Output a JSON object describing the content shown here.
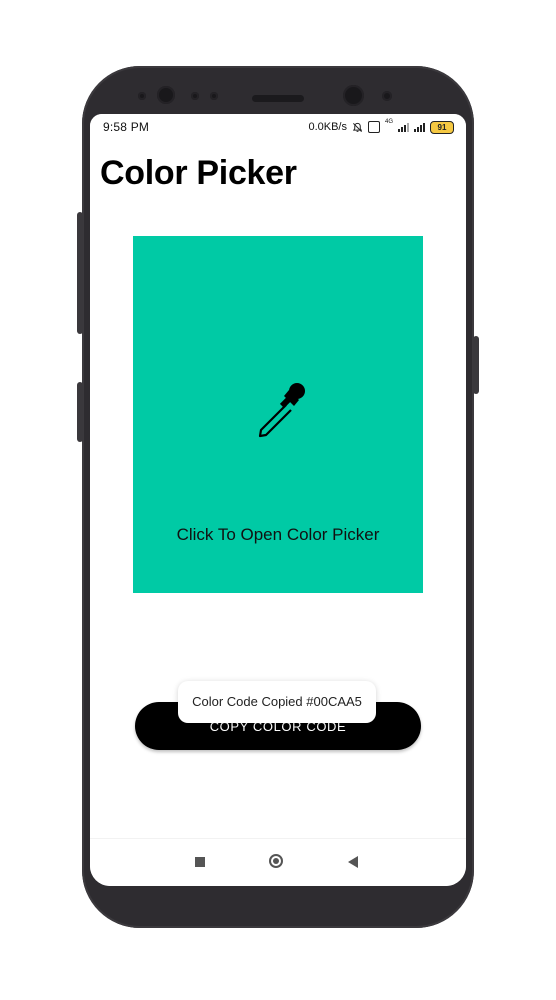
{
  "status_bar": {
    "time": "9:58 PM",
    "net_speed": "0.0KB/s",
    "network_label": "4G",
    "battery_level": "91"
  },
  "app": {
    "title": "Color Picker"
  },
  "picker": {
    "label": "Click To Open Color Picker",
    "color": "#00CAA5",
    "icon": "eyedropper-icon"
  },
  "copy_button": {
    "label": "COPY COLOR CODE"
  },
  "toast": {
    "message": "Color Code Copied #00CAA5"
  },
  "nav": {
    "recent_icon": "recent-apps-icon",
    "home_icon": "home-icon",
    "back_icon": "back-icon"
  }
}
